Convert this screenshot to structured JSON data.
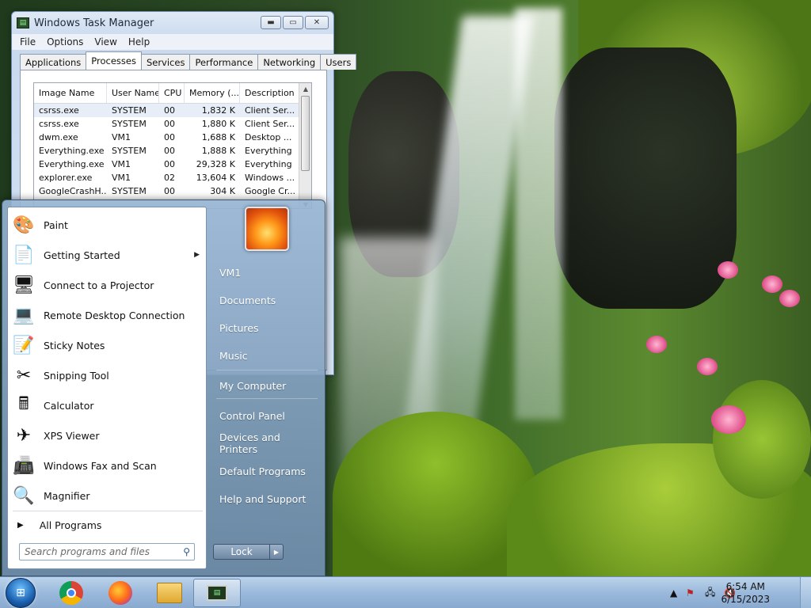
{
  "task_manager": {
    "title": "Windows Task Manager",
    "menu": [
      "File",
      "Options",
      "View",
      "Help"
    ],
    "tabs": [
      "Applications",
      "Processes",
      "Services",
      "Performance",
      "Networking",
      "Users"
    ],
    "active_tab": "Processes",
    "columns": [
      "Image Name",
      "User Name",
      "CPU",
      "Memory (...",
      "Description"
    ],
    "rows": [
      {
        "image": "csrss.exe",
        "user": "SYSTEM",
        "cpu": "00",
        "mem": "1,832 K",
        "desc": "Client Ser..."
      },
      {
        "image": "csrss.exe",
        "user": "SYSTEM",
        "cpu": "00",
        "mem": "1,880 K",
        "desc": "Client Ser..."
      },
      {
        "image": "dwm.exe",
        "user": "VM1",
        "cpu": "00",
        "mem": "1,688 K",
        "desc": "Desktop ..."
      },
      {
        "image": "Everything.exe",
        "user": "SYSTEM",
        "cpu": "00",
        "mem": "1,888 K",
        "desc": "Everything"
      },
      {
        "image": "Everything.exe",
        "user": "VM1",
        "cpu": "00",
        "mem": "29,328 K",
        "desc": "Everything"
      },
      {
        "image": "explorer.exe",
        "user": "VM1",
        "cpu": "02",
        "mem": "13,604 K",
        "desc": "Windows ..."
      },
      {
        "image": "GoogleCrashH...",
        "user": "SYSTEM",
        "cpu": "00",
        "mem": "304 K",
        "desc": "Google Cr..."
      }
    ]
  },
  "start_menu": {
    "programs": [
      {
        "label": "Paint",
        "icon": "paint-icon",
        "glyph": "🎨"
      },
      {
        "label": "Getting Started",
        "icon": "getting-started-icon",
        "glyph": "📄",
        "submenu": "▶"
      },
      {
        "label": "Connect to a Projector",
        "icon": "projector-icon",
        "glyph": "🖥"
      },
      {
        "label": "Remote Desktop Connection",
        "icon": "remote-desktop-icon",
        "glyph": "💻"
      },
      {
        "label": "Sticky Notes",
        "icon": "sticky-notes-icon",
        "glyph": "📝"
      },
      {
        "label": "Snipping Tool",
        "icon": "snipping-tool-icon",
        "glyph": "✂"
      },
      {
        "label": "Calculator",
        "icon": "calculator-icon",
        "glyph": "🖩"
      },
      {
        "label": "XPS Viewer",
        "icon": "xps-viewer-icon",
        "glyph": "✈"
      },
      {
        "label": "Windows Fax and Scan",
        "icon": "fax-scan-icon",
        "glyph": "📠"
      },
      {
        "label": "Magnifier",
        "icon": "magnifier-icon",
        "glyph": "🔍"
      }
    ],
    "all_programs": "All Programs",
    "search_placeholder": "Search programs and files",
    "right_links": [
      "VM1",
      "Documents",
      "Pictures",
      "Music",
      "My Computer",
      "Control Panel",
      "Devices and Printers",
      "Default Programs",
      "Help and Support"
    ],
    "lock_label": "Lock"
  },
  "taskbar": {
    "time": "6:54 AM",
    "date": "6/15/2023"
  }
}
